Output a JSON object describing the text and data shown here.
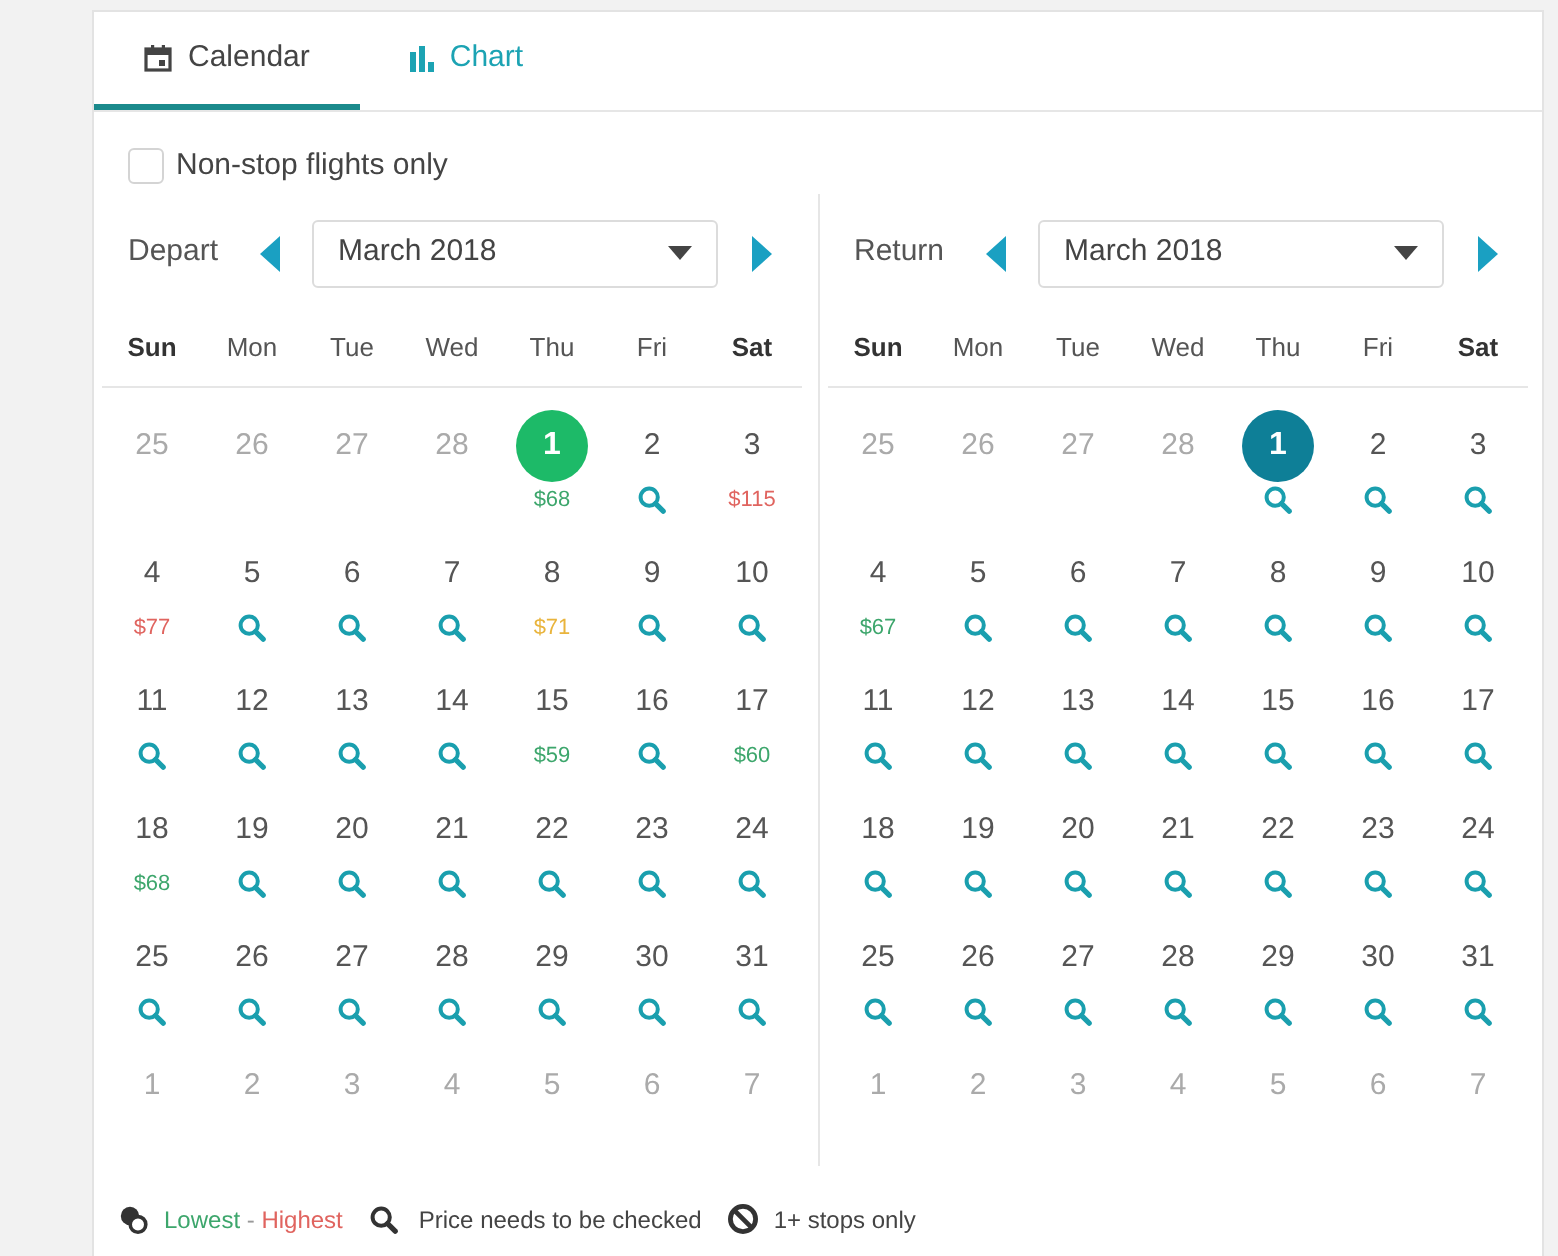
{
  "tabs": [
    {
      "label": "Calendar",
      "selected": true
    },
    {
      "label": "Chart",
      "selected": false
    }
  ],
  "nonstop_filter": {
    "label": "Non-stop flights only",
    "checked": false
  },
  "calendars": [
    {
      "label": "Depart",
      "month": "March 2018",
      "color": "#1dba68",
      "weekdays": [
        {
          "label": "Sun",
          "weekend": true
        },
        {
          "label": "Mon",
          "weekend": false
        },
        {
          "label": "Tue",
          "weekend": false
        },
        {
          "label": "Wed",
          "weekend": false
        },
        {
          "label": "Thu",
          "weekend": false
        },
        {
          "label": "Fri",
          "weekend": false
        },
        {
          "label": "Sat",
          "weekend": true
        }
      ],
      "days": [
        {
          "day": "25",
          "other_month": true,
          "selected": false
        },
        {
          "day": "26",
          "other_month": true,
          "selected": false
        },
        {
          "day": "27",
          "other_month": true,
          "selected": false
        },
        {
          "day": "28",
          "other_month": true,
          "selected": false
        },
        {
          "day": "1",
          "other_month": false,
          "selected": true,
          "fare": {
            "kind": "price",
            "text": "$68",
            "color": "#3da66c"
          }
        },
        {
          "day": "2",
          "other_month": false,
          "selected": false,
          "fare": {
            "kind": "check"
          }
        },
        {
          "day": "3",
          "other_month": false,
          "selected": false,
          "fare": {
            "kind": "price",
            "text": "$115",
            "color": "#e0645f"
          }
        },
        {
          "day": "4",
          "other_month": false,
          "selected": false,
          "fare": {
            "kind": "price",
            "text": "$77",
            "color": "#e0645f"
          }
        },
        {
          "day": "5",
          "other_month": false,
          "selected": false,
          "fare": {
            "kind": "check"
          }
        },
        {
          "day": "6",
          "other_month": false,
          "selected": false,
          "fare": {
            "kind": "check"
          }
        },
        {
          "day": "7",
          "other_month": false,
          "selected": false,
          "fare": {
            "kind": "check"
          }
        },
        {
          "day": "8",
          "other_month": false,
          "selected": false,
          "fare": {
            "kind": "price",
            "text": "$71",
            "color": "#e9b43c"
          }
        },
        {
          "day": "9",
          "other_month": false,
          "selected": false,
          "fare": {
            "kind": "check"
          }
        },
        {
          "day": "10",
          "other_month": false,
          "selected": false,
          "fare": {
            "kind": "check"
          }
        },
        {
          "day": "11",
          "other_month": false,
          "selected": false,
          "fare": {
            "kind": "check"
          }
        },
        {
          "day": "12",
          "other_month": false,
          "selected": false,
          "fare": {
            "kind": "check"
          }
        },
        {
          "day": "13",
          "other_month": false,
          "selected": false,
          "fare": {
            "kind": "check"
          }
        },
        {
          "day": "14",
          "other_month": false,
          "selected": false,
          "fare": {
            "kind": "check"
          }
        },
        {
          "day": "15",
          "other_month": false,
          "selected": false,
          "fare": {
            "kind": "price",
            "text": "$59",
            "color": "#3da66c"
          }
        },
        {
          "day": "16",
          "other_month": false,
          "selected": false,
          "fare": {
            "kind": "check"
          }
        },
        {
          "day": "17",
          "other_month": false,
          "selected": false,
          "fare": {
            "kind": "price",
            "text": "$60",
            "color": "#3da66c"
          }
        },
        {
          "day": "18",
          "other_month": false,
          "selected": false,
          "fare": {
            "kind": "price",
            "text": "$68",
            "color": "#3da66c"
          }
        },
        {
          "day": "19",
          "other_month": false,
          "selected": false,
          "fare": {
            "kind": "check"
          }
        },
        {
          "day": "20",
          "other_month": false,
          "selected": false,
          "fare": {
            "kind": "check"
          }
        },
        {
          "day": "21",
          "other_month": false,
          "selected": false,
          "fare": {
            "kind": "check"
          }
        },
        {
          "day": "22",
          "other_month": false,
          "selected": false,
          "fare": {
            "kind": "check"
          }
        },
        {
          "day": "23",
          "other_month": false,
          "selected": false,
          "fare": {
            "kind": "check"
          }
        },
        {
          "day": "24",
          "other_month": false,
          "selected": false,
          "fare": {
            "kind": "check"
          }
        },
        {
          "day": "25",
          "other_month": false,
          "selected": false,
          "fare": {
            "kind": "check"
          }
        },
        {
          "day": "26",
          "other_month": false,
          "selected": false,
          "fare": {
            "kind": "check"
          }
        },
        {
          "day": "27",
          "other_month": false,
          "selected": false,
          "fare": {
            "kind": "check"
          }
        },
        {
          "day": "28",
          "other_month": false,
          "selected": false,
          "fare": {
            "kind": "check"
          }
        },
        {
          "day": "29",
          "other_month": false,
          "selected": false,
          "fare": {
            "kind": "check"
          }
        },
        {
          "day": "30",
          "other_month": false,
          "selected": false,
          "fare": {
            "kind": "check"
          }
        },
        {
          "day": "31",
          "other_month": false,
          "selected": false,
          "fare": {
            "kind": "check"
          }
        },
        {
          "day": "1",
          "other_month": true,
          "selected": false
        },
        {
          "day": "2",
          "other_month": true,
          "selected": false
        },
        {
          "day": "3",
          "other_month": true,
          "selected": false
        },
        {
          "day": "4",
          "other_month": true,
          "selected": false
        },
        {
          "day": "5",
          "other_month": true,
          "selected": false
        },
        {
          "day": "6",
          "other_month": true,
          "selected": false
        },
        {
          "day": "7",
          "other_month": true,
          "selected": false
        }
      ]
    },
    {
      "label": "Return",
      "month": "March 2018",
      "color": "#0e7f97",
      "weekdays": [
        {
          "label": "Sun",
          "weekend": true
        },
        {
          "label": "Mon",
          "weekend": false
        },
        {
          "label": "Tue",
          "weekend": false
        },
        {
          "label": "Wed",
          "weekend": false
        },
        {
          "label": "Thu",
          "weekend": false
        },
        {
          "label": "Fri",
          "weekend": false
        },
        {
          "label": "Sat",
          "weekend": true
        }
      ],
      "days": [
        {
          "day": "25",
          "other_month": true,
          "selected": false
        },
        {
          "day": "26",
          "other_month": true,
          "selected": false
        },
        {
          "day": "27",
          "other_month": true,
          "selected": false
        },
        {
          "day": "28",
          "other_month": true,
          "selected": false
        },
        {
          "day": "1",
          "other_month": false,
          "selected": true,
          "fare": {
            "kind": "check"
          }
        },
        {
          "day": "2",
          "other_month": false,
          "selected": false,
          "fare": {
            "kind": "check"
          }
        },
        {
          "day": "3",
          "other_month": false,
          "selected": false,
          "fare": {
            "kind": "check"
          }
        },
        {
          "day": "4",
          "other_month": false,
          "selected": false,
          "fare": {
            "kind": "price",
            "text": "$67",
            "color": "#3da66c"
          }
        },
        {
          "day": "5",
          "other_month": false,
          "selected": false,
          "fare": {
            "kind": "check"
          }
        },
        {
          "day": "6",
          "other_month": false,
          "selected": false,
          "fare": {
            "kind": "check"
          }
        },
        {
          "day": "7",
          "other_month": false,
          "selected": false,
          "fare": {
            "kind": "check"
          }
        },
        {
          "day": "8",
          "other_month": false,
          "selected": false,
          "fare": {
            "kind": "check"
          }
        },
        {
          "day": "9",
          "other_month": false,
          "selected": false,
          "fare": {
            "kind": "check"
          }
        },
        {
          "day": "10",
          "other_month": false,
          "selected": false,
          "fare": {
            "kind": "check"
          }
        },
        {
          "day": "11",
          "other_month": false,
          "selected": false,
          "fare": {
            "kind": "check"
          }
        },
        {
          "day": "12",
          "other_month": false,
          "selected": false,
          "fare": {
            "kind": "check"
          }
        },
        {
          "day": "13",
          "other_month": false,
          "selected": false,
          "fare": {
            "kind": "check"
          }
        },
        {
          "day": "14",
          "other_month": false,
          "selected": false,
          "fare": {
            "kind": "check"
          }
        },
        {
          "day": "15",
          "other_month": false,
          "selected": false,
          "fare": {
            "kind": "check"
          }
        },
        {
          "day": "16",
          "other_month": false,
          "selected": false,
          "fare": {
            "kind": "check"
          }
        },
        {
          "day": "17",
          "other_month": false,
          "selected": false,
          "fare": {
            "kind": "check"
          }
        },
        {
          "day": "18",
          "other_month": false,
          "selected": false,
          "fare": {
            "kind": "check"
          }
        },
        {
          "day": "19",
          "other_month": false,
          "selected": false,
          "fare": {
            "kind": "check"
          }
        },
        {
          "day": "20",
          "other_month": false,
          "selected": false,
          "fare": {
            "kind": "check"
          }
        },
        {
          "day": "21",
          "other_month": false,
          "selected": false,
          "fare": {
            "kind": "check"
          }
        },
        {
          "day": "22",
          "other_month": false,
          "selected": false,
          "fare": {
            "kind": "check"
          }
        },
        {
          "day": "23",
          "other_month": false,
          "selected": false,
          "fare": {
            "kind": "check"
          }
        },
        {
          "day": "24",
          "other_month": false,
          "selected": false,
          "fare": {
            "kind": "check"
          }
        },
        {
          "day": "25",
          "other_month": false,
          "selected": false,
          "fare": {
            "kind": "check"
          }
        },
        {
          "day": "26",
          "other_month": false,
          "selected": false,
          "fare": {
            "kind": "check"
          }
        },
        {
          "day": "27",
          "other_month": false,
          "selected": false,
          "fare": {
            "kind": "check"
          }
        },
        {
          "day": "28",
          "other_month": false,
          "selected": false,
          "fare": {
            "kind": "check"
          }
        },
        {
          "day": "29",
          "other_month": false,
          "selected": false,
          "fare": {
            "kind": "check"
          }
        },
        {
          "day": "30",
          "other_month": false,
          "selected": false,
          "fare": {
            "kind": "check"
          }
        },
        {
          "day": "31",
          "other_month": false,
          "selected": false,
          "fare": {
            "kind": "check"
          }
        },
        {
          "day": "1",
          "other_month": true,
          "selected": false
        },
        {
          "day": "2",
          "other_month": true,
          "selected": false
        },
        {
          "day": "3",
          "other_month": true,
          "selected": false
        },
        {
          "day": "4",
          "other_month": true,
          "selected": false
        },
        {
          "day": "5",
          "other_month": true,
          "selected": false
        },
        {
          "day": "6",
          "other_month": true,
          "selected": false
        },
        {
          "day": "7",
          "other_month": true,
          "selected": false
        }
      ]
    }
  ],
  "legend": [
    {
      "kind": "range",
      "low": "Lowest",
      "separator": "-",
      "high": "Highest"
    },
    {
      "kind": "check",
      "label": "Price needs to be checked"
    },
    {
      "kind": "stops",
      "label": "1+ stops only"
    }
  ]
}
